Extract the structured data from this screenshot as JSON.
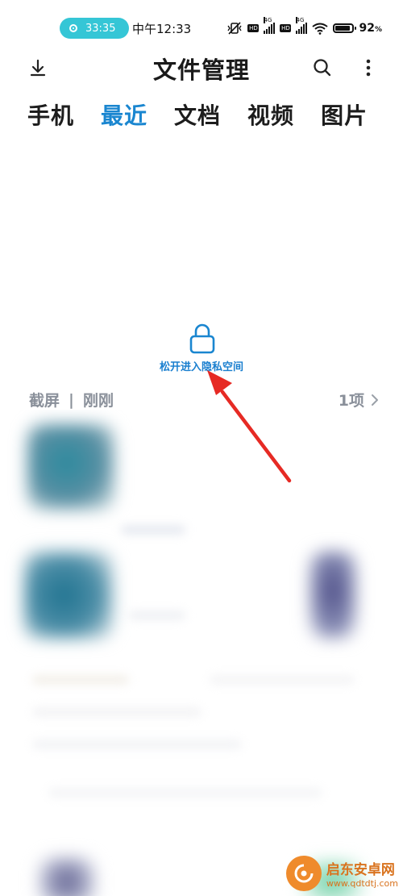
{
  "status_bar": {
    "record_timer": "33:35",
    "clock": "中午12:33",
    "sim1_label": "4G",
    "sim2_label": "4G",
    "hd_label": "HD",
    "battery_percent": "92",
    "battery_unit": "%"
  },
  "header": {
    "title": "文件管理",
    "download_icon": "download-icon",
    "search_icon": "search-icon",
    "more_icon": "more-vertical-icon"
  },
  "tabs": [
    {
      "label": "手机",
      "active": false
    },
    {
      "label": "最近",
      "active": true
    },
    {
      "label": "文档",
      "active": false
    },
    {
      "label": "视频",
      "active": false
    },
    {
      "label": "图片",
      "active": false
    }
  ],
  "private_space": {
    "icon": "lock-icon",
    "hint": "松开进入隐私空间"
  },
  "section": {
    "category": "截屏",
    "separator": "|",
    "time": "刚刚",
    "count": "1项"
  },
  "watermark": {
    "name": "启东安卓网",
    "url": "www.qdtdtj.com"
  },
  "colors": {
    "accent": "#1a86d0",
    "annotation_arrow": "#e62a24",
    "record_pill": "#35c6d6"
  }
}
